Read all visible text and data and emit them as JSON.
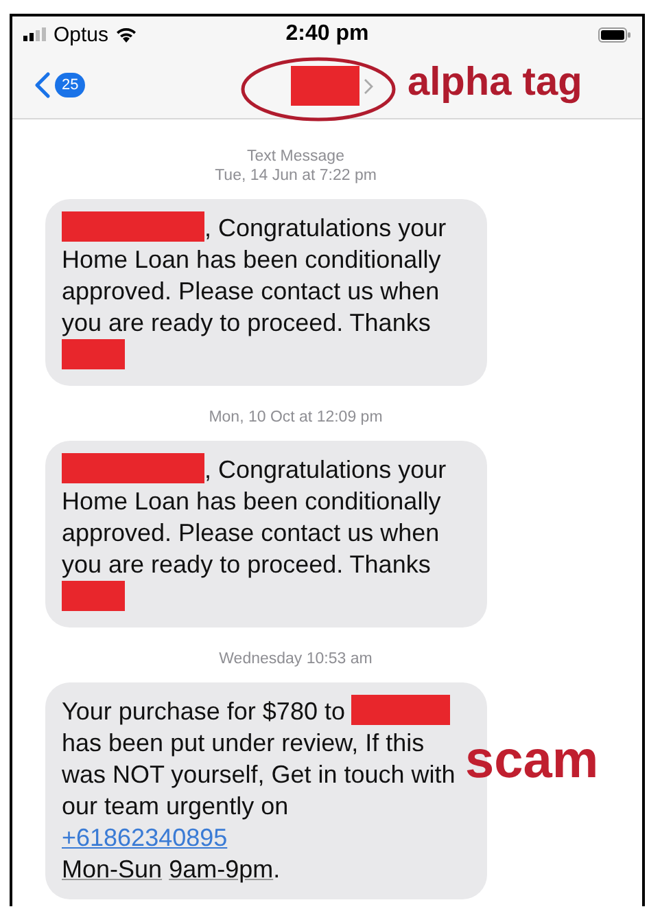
{
  "status_bar": {
    "carrier": "Optus",
    "time": "2:40 pm"
  },
  "nav_bar": {
    "unread_count": "25",
    "contact": {
      "redacted": true
    }
  },
  "annotations": [
    {
      "kind": "ellipse_label",
      "text": "alpha tag"
    },
    {
      "kind": "side_label",
      "text": "scam"
    }
  ],
  "thread": [
    {
      "kind": "timestamp",
      "lines": [
        "Text Message",
        "Tue, 14 Jun at 7:22 pm"
      ]
    },
    {
      "kind": "message",
      "parts": [
        {
          "kind": "redaction"
        },
        {
          "kind": "text",
          "text": ", Congratulations your"
        },
        {
          "kind": "block_text",
          "text": "Home Loan has been conditionally\napproved. Please contact us when\nyou are ready to proceed. Thanks"
        },
        {
          "kind": "redaction"
        }
      ]
    },
    {
      "kind": "timestamp",
      "lines": [
        "Mon, 10 Oct at 12:09 pm"
      ]
    },
    {
      "kind": "message",
      "parts": [
        {
          "kind": "redaction"
        },
        {
          "kind": "text",
          "text": ", Congratulations your"
        },
        {
          "kind": "block_text",
          "text": "Home Loan has been conditionally\napproved. Please contact us when\nyou are ready to proceed. Thanks"
        },
        {
          "kind": "redaction"
        }
      ]
    },
    {
      "kind": "timestamp",
      "lines": [
        "Wednesday 10:53 am"
      ]
    },
    {
      "kind": "message",
      "parts": [
        {
          "kind": "text",
          "text": "Your purchase for $780 to "
        },
        {
          "kind": "redaction"
        },
        {
          "kind": "block_text",
          "text": "has been put under review, If this\nwas NOT yourself, Get in touch with\nour team urgently on"
        },
        {
          "kind": "link",
          "text": "+61862340895"
        },
        {
          "kind": "detected",
          "text": "Mon-Sun"
        },
        {
          "kind": "detected",
          "text": "9am-9pm"
        },
        {
          "kind": "text",
          "text": "."
        }
      ]
    }
  ]
}
